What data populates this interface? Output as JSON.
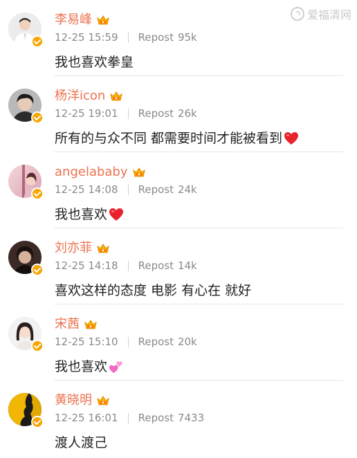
{
  "watermark": {
    "text": "爱福清网"
  },
  "comments": [
    {
      "name": "李易峰",
      "time": "12-25 15:59",
      "repost_label": "Repost",
      "repost_count": "95k",
      "text": "我也喜欢拳皇",
      "emoji": "",
      "avatar_icon": "avatar-man-white-shirt"
    },
    {
      "name": "杨洋icon",
      "time": "12-25 19:01",
      "repost_label": "Repost",
      "repost_count": "26k",
      "text": "所有的与众不同 都需要时间才能被看到",
      "emoji": "red-heart",
      "avatar_icon": "avatar-man-dark-hair"
    },
    {
      "name": "angelababy",
      "time": "12-25 14:08",
      "repost_label": "Repost",
      "repost_count": "24k",
      "text": "我也喜欢",
      "emoji": "red-heart",
      "avatar_icon": "avatar-woman-pink-blur"
    },
    {
      "name": "刘亦菲",
      "time": "12-25 14:18",
      "repost_label": "Repost",
      "repost_count": "14k",
      "text": "喜欢这样的态度 电影 有心在 就好",
      "emoji": "",
      "avatar_icon": "avatar-woman-dark"
    },
    {
      "name": "宋茜",
      "time": "12-25 15:10",
      "repost_label": "Repost",
      "repost_count": "20k",
      "text": "我也喜欢",
      "emoji": "pink-hearts",
      "avatar_icon": "avatar-woman-light"
    },
    {
      "name": "黄晓明",
      "time": "12-25 16:01",
      "repost_label": "Repost",
      "repost_count": "7433",
      "text": "渡人渡己",
      "emoji": "",
      "avatar_icon": "avatar-yellow-silhouette"
    }
  ],
  "colors": {
    "name": "#eb7350",
    "meta": "#8a8a8a",
    "verified_badge": "#f7a600",
    "heart": "#e8232e",
    "pink_heart": "#f06ac0"
  }
}
